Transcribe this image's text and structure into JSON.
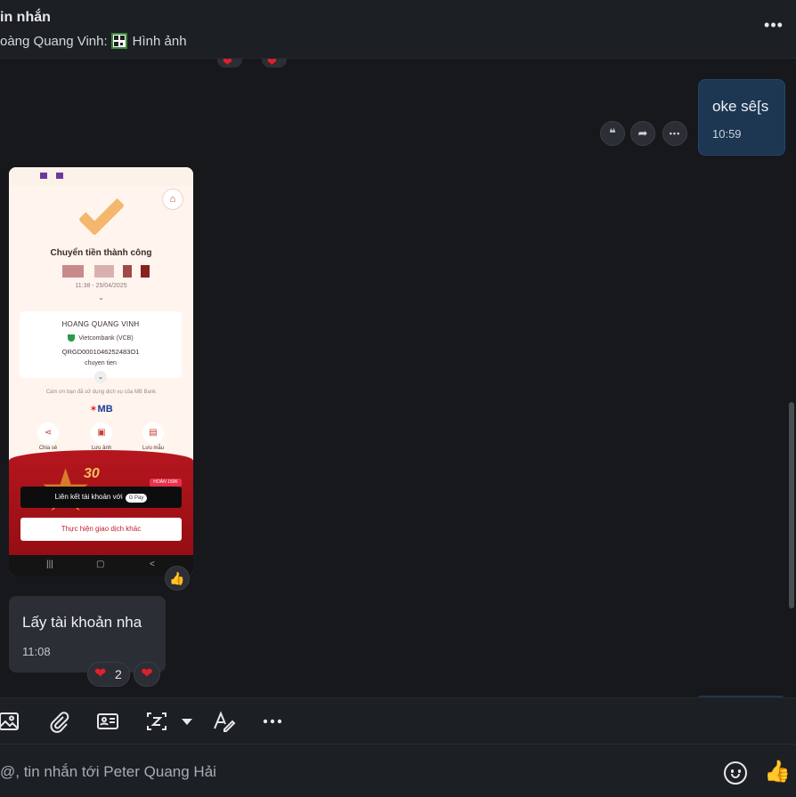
{
  "header": {
    "title": "in nhắn",
    "last_sender": "oàng Quang Vinh:",
    "last_preview": "Hình ảnh",
    "more_label": "•••"
  },
  "messages": {
    "outgoing": {
      "text": "oke sê[s",
      "time": "10:59"
    },
    "actions": {
      "quote": "❝",
      "forward": "➦",
      "more": "•••"
    },
    "image": {
      "success_title": "Chuyển tiền thành công",
      "datetime": "11:38 - 25/04/2025",
      "recipient_name": "HOANG QUANG VINH",
      "bank": "Vietcombank (VCB)",
      "transaction_code": "QRGD0001046252483O1",
      "note": "chuyen tien",
      "thanks": "Cám ơn bạn đã sử dụng dịch vụ của MB Bank",
      "brand": "MB",
      "actions": [
        "Chia sẻ",
        "Lưu ảnh",
        "Lưu mẫu"
      ],
      "promo_number": "30",
      "promo_badge": "HOÀN 150K",
      "link_button": "Liên kết tài khoản với",
      "gpay": "G Pay",
      "other_button": "Thực hiện giao dịch khác"
    },
    "incoming": {
      "text": "Lấy tài khoản nha",
      "time": "11:08"
    },
    "reactions": {
      "heart": "❤",
      "count": "2"
    }
  },
  "composer": {
    "placeholder": "@, tin nhắn tới Peter Quang Hải"
  },
  "colors": {
    "background": "#16181c",
    "panel": "#1c1f24",
    "outgoing_bubble": "#1d3651",
    "incoming_bubble": "#2b2e34",
    "heart": "#e0202a"
  }
}
